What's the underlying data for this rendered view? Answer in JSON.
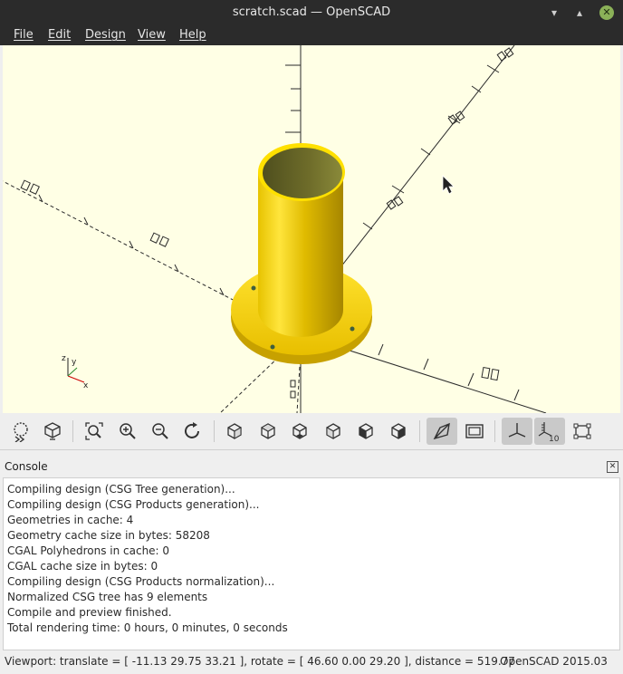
{
  "window": {
    "title": "scratch.scad — OpenSCAD",
    "minimize_glyph": "▾",
    "maximize_glyph": "▴",
    "close_glyph": "✕"
  },
  "menubar": {
    "items": [
      {
        "label": "File"
      },
      {
        "label": "Edit"
      },
      {
        "label": "Design"
      },
      {
        "label": "View"
      },
      {
        "label": "Help"
      }
    ]
  },
  "viewport": {
    "background": "#ffffe5",
    "model_color": "#f8d400",
    "axis_label_glyph": "▯▯",
    "icons": [
      "axes-indicator-icon",
      "mouse-cursor-icon"
    ]
  },
  "toolbar": {
    "buttons": [
      {
        "name": "preview-button",
        "icon": "preview-icon"
      },
      {
        "name": "render-button",
        "icon": "render-icon"
      },
      {
        "name": "view-all-button",
        "icon": "view-all-icon"
      },
      {
        "name": "zoom-in-button",
        "icon": "zoom-in-icon"
      },
      {
        "name": "zoom-out-button",
        "icon": "zoom-out-icon"
      },
      {
        "name": "reset-view-button",
        "icon": "reset-view-icon"
      },
      {
        "name": "view-right-button",
        "icon": "cube-right-icon"
      },
      {
        "name": "view-top-button",
        "icon": "cube-top-icon"
      },
      {
        "name": "view-bottom-button",
        "icon": "cube-bottom-icon"
      },
      {
        "name": "view-left-button",
        "icon": "cube-left-icon"
      },
      {
        "name": "view-front-button",
        "icon": "cube-front-icon"
      },
      {
        "name": "view-back-button",
        "icon": "cube-back-icon"
      },
      {
        "name": "perspective-button",
        "icon": "perspective-icon",
        "active": true
      },
      {
        "name": "orthogonal-button",
        "icon": "orthogonal-icon"
      },
      {
        "name": "show-axes-button",
        "icon": "axes-icon",
        "active": true
      },
      {
        "name": "show-scale-button",
        "icon": "scale-markers-icon",
        "active": true,
        "label": "10"
      },
      {
        "name": "show-edges-button",
        "icon": "edges-icon"
      }
    ]
  },
  "console": {
    "title": "Console",
    "close_glyph": "✕",
    "lines": [
      "Compiling design (CSG Tree generation)...",
      "Compiling design (CSG Products generation)...",
      "Geometries in cache: 4",
      "Geometry cache size in bytes: 58208",
      "CGAL Polyhedrons in cache: 0",
      "CGAL cache size in bytes: 0",
      "Compiling design (CSG Products normalization)...",
      "Normalized CSG tree has 9 elements",
      "Compile and preview finished.",
      "Total rendering time: 0 hours, 0 minutes, 0 seconds"
    ]
  },
  "statusbar": {
    "viewport_info": "Viewport: translate = [ -11.13 29.75 33.21 ], rotate = [ 46.60 0.00 29.20 ], distance = 519.77",
    "version": "OpenSCAD 2015.03"
  }
}
